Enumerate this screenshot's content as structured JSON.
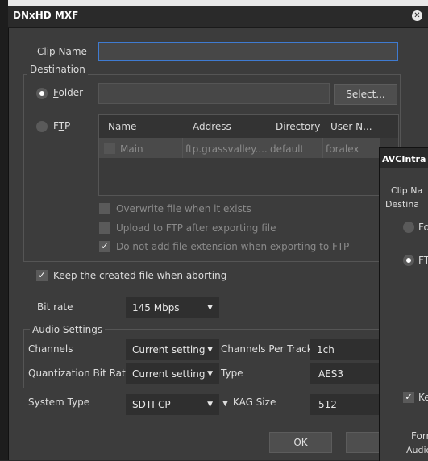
{
  "window": {
    "title": "DNxHD MXF",
    "close_icon": "close-circle-icon"
  },
  "clip_name": {
    "label": "Clip Name",
    "value": ""
  },
  "destination": {
    "group_title": "Destination",
    "folder": {
      "label": "Folder",
      "selected": true,
      "path": "",
      "select_button": "Select..."
    },
    "ftp": {
      "label": "FTP",
      "selected": false,
      "columns": [
        "Name",
        "Address",
        "Directory",
        "User N..."
      ],
      "rows": [
        {
          "checked": false,
          "name": "Main",
          "address": "ftp.grassvalley....",
          "directory": "default",
          "user": "foralex"
        }
      ]
    },
    "options": [
      {
        "label": "Overwrite file when it exists",
        "checked": false
      },
      {
        "label": "Upload to FTP after exporting file",
        "checked": false
      },
      {
        "label": "Do not add file extension when exporting to FTP",
        "checked": true
      }
    ]
  },
  "keep_file": {
    "label": "Keep the created file when aborting",
    "checked": true
  },
  "bit_rate": {
    "label": "Bit rate",
    "value": "145 Mbps"
  },
  "audio": {
    "group_title": "Audio Settings",
    "channels": {
      "label": "Channels",
      "value": "Current setting"
    },
    "channels_per_track": {
      "label": "Channels Per Track",
      "value": "1ch"
    },
    "quantization": {
      "label": "Quantization Bit Rate",
      "value": "Current setting"
    },
    "type": {
      "label": "Type",
      "value": "AES3"
    }
  },
  "system_type": {
    "label": "System Type",
    "value": "SDTI-CP"
  },
  "kag_size": {
    "label": "KAG Size",
    "value": "512"
  },
  "buttons": {
    "ok": "OK",
    "cancel": "Ca"
  },
  "second_window": {
    "title": "AVCIntra",
    "clip_label": "Clip Na",
    "destination_label": "Destina",
    "folder_label": "Fo",
    "ftp_label": "FT",
    "keep_label": "Ke",
    "format_label": "Form",
    "audio_label": "Audio"
  }
}
